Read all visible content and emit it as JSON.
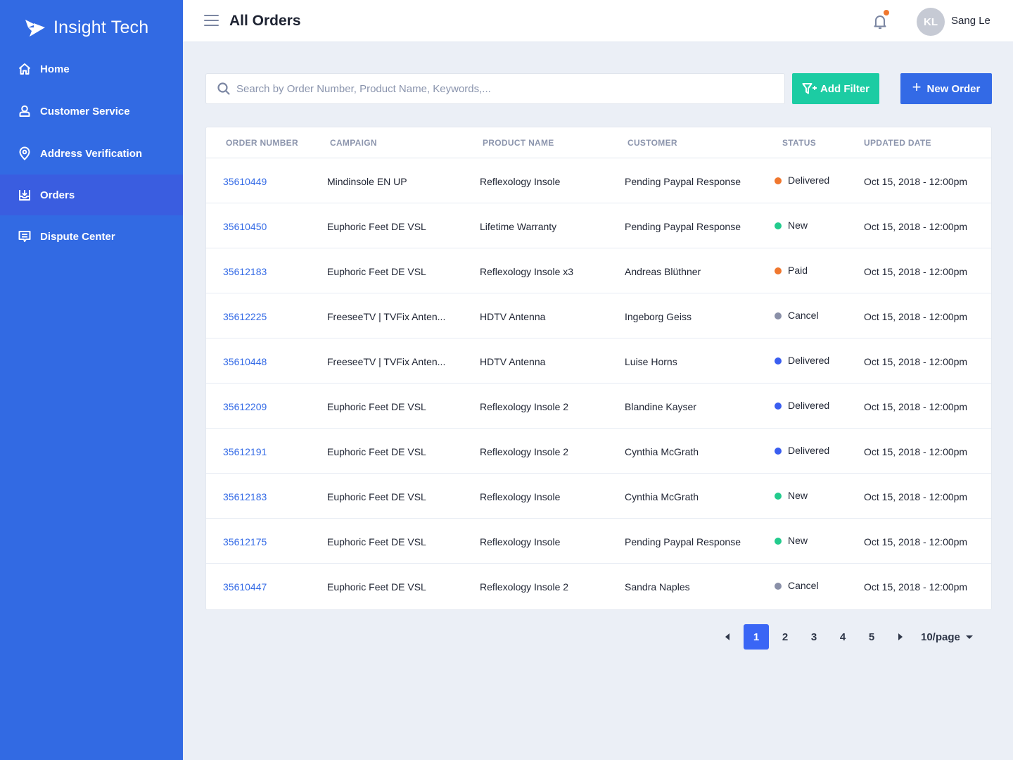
{
  "brand": {
    "name": "Insight Tech",
    "logo_icon": "arrow-logo-icon"
  },
  "sidebar": {
    "items": [
      {
        "label": "Home",
        "icon": "home-icon",
        "active": false
      },
      {
        "label": "Customer Service",
        "icon": "user-icon",
        "active": false
      },
      {
        "label": "Address Verification",
        "icon": "map-pin-icon",
        "active": false
      },
      {
        "label": "Orders",
        "icon": "inbox-download-icon",
        "active": true
      },
      {
        "label": "Dispute Center",
        "icon": "chat-icon",
        "active": false
      }
    ]
  },
  "header": {
    "title": "All Orders",
    "user": {
      "initials": "KL",
      "name": "Sang Le"
    },
    "notifications": {
      "has_unread": true
    }
  },
  "toolbar": {
    "search_placeholder": "Search by Order Number, Product Name, Keywords,...",
    "search_value": "",
    "add_filter_label": "Add Filter",
    "new_order_label": "New Order",
    "new_order_plus": "+"
  },
  "table": {
    "columns": [
      "ORDER NUMBER",
      "CAMPAIGN",
      "PRODUCT NAME",
      "CUSTOMER",
      "STATUS",
      "UPDATED DATE"
    ],
    "rows": [
      {
        "order": "35610449",
        "campaign": "Mindinsole EN UP",
        "product": "Reflexology Insole",
        "customer": "Pending Paypal Response",
        "status": "Delivered",
        "status_color": "#f0772e",
        "date": "Oct 15, 2018 - 12:00pm"
      },
      {
        "order": "35610450",
        "campaign": "Euphoric Feet DE VSL",
        "product": "Lifetime Warranty",
        "customer": "Pending Paypal Response",
        "status": "New",
        "status_color": "#23cb8d",
        "date": "Oct 15, 2018 - 12:00pm"
      },
      {
        "order": "35612183",
        "campaign": "Euphoric Feet DE VSL",
        "product": "Reflexology Insole x3",
        "customer": "Andreas Blüthner",
        "status": "Paid",
        "status_color": "#f0772e",
        "date": "Oct 15, 2018 - 12:00pm"
      },
      {
        "order": "35612225",
        "campaign": "FreeseeTV | TVFix Anten...",
        "product": "HDTV Antenna",
        "customer": "Ingeborg Geiss",
        "status": "Cancel",
        "status_color": "#8a90a8",
        "date": "Oct 15, 2018 - 12:00pm"
      },
      {
        "order": "35610448",
        "campaign": "FreeseeTV | TVFix Anten...",
        "product": "HDTV Antenna",
        "customer": "Luise Horns",
        "status": "Delivered",
        "status_color": "#3a5ef0",
        "date": "Oct 15, 2018 - 12:00pm"
      },
      {
        "order": "35612209",
        "campaign": "Euphoric Feet DE VSL",
        "product": "Reflexology Insole 2",
        "customer": "Blandine Kayser",
        "status": "Delivered",
        "status_color": "#3a5ef0",
        "date": "Oct 15, 2018 - 12:00pm"
      },
      {
        "order": "35612191",
        "campaign": "Euphoric Feet DE VSL",
        "product": "Reflexology Insole 2",
        "customer": "Cynthia McGrath",
        "status": "Delivered",
        "status_color": "#3a5ef0",
        "date": "Oct 15, 2018 - 12:00pm"
      },
      {
        "order": "35612183",
        "campaign": "Euphoric Feet DE VSL",
        "product": "Reflexology Insole",
        "customer": "Cynthia McGrath",
        "status": "New",
        "status_color": "#23cb8d",
        "date": "Oct 15, 2018 - 12:00pm"
      },
      {
        "order": "35612175",
        "campaign": "Euphoric Feet DE VSL",
        "product": "Reflexology Insole",
        "customer": "Pending Paypal Response",
        "status": "New",
        "status_color": "#23cb8d",
        "date": "Oct 15, 2018 - 12:00pm"
      },
      {
        "order": "35610447",
        "campaign": "Euphoric Feet DE VSL",
        "product": "Reflexology Insole 2",
        "customer": "Sandra Naples",
        "status": "Cancel",
        "status_color": "#8a90a8",
        "date": "Oct 15, 2018 - 12:00pm"
      }
    ]
  },
  "pagination": {
    "pages": [
      "1",
      "2",
      "3",
      "4",
      "5"
    ],
    "current": "1",
    "page_size": "10/page"
  },
  "colors": {
    "sidebar_bg": "#326ae3",
    "sidebar_active": "#3a5de0",
    "primary": "#336ae6",
    "filter_button": "#1ccca3",
    "notification_dot": "#f0772e"
  }
}
